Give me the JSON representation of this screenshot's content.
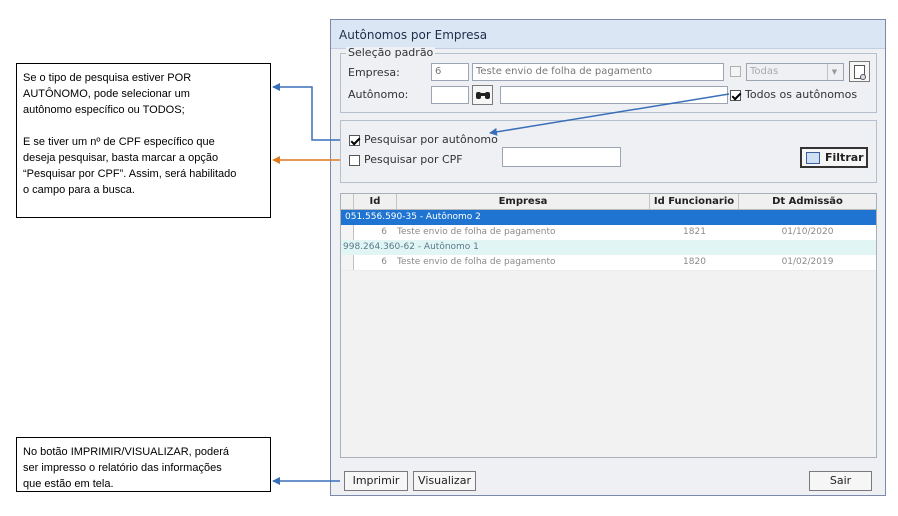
{
  "notes": {
    "note1": [
      "Se o tipo de pesquisa estiver POR",
      "AUTÔNOMO, pode selecionar um",
      "autônomo específico ou TODOS;",
      "",
      "E se tiver um nº de CPF específico que",
      "deseja pesquisar, basta marcar a opção",
      "“Pesquisar por CPF”. Assim, será habilitado",
      "o campo para a busca."
    ],
    "note2": [
      "No botão IMPRIMIR/VISUALIZAR, poderá",
      "ser impresso o relatório das informações",
      "que estão em tela."
    ]
  },
  "window": {
    "title": "Autônomos por Empresa"
  },
  "selecao": {
    "legend": "Seleção padrão",
    "empresa_label": "Empresa:",
    "empresa_code": "6",
    "empresa_name": "Teste envio de folha de pagamento",
    "todas_value": "Todas",
    "autonomo_label": "Autônomo:",
    "autonomo_code": "",
    "autonomo_name": "",
    "todos_label": "Todos os autônomos",
    "todos_checked": true
  },
  "pesquisa": {
    "por_autonomo_label": "Pesquisar por autônomo",
    "por_autonomo_checked": true,
    "por_cpf_label": "Pesquisar por CPF",
    "por_cpf_checked": false,
    "cpf_value": "",
    "filtrar_label": "Filtrar"
  },
  "grid": {
    "columns": [
      "Id",
      "Empresa",
      "Id Funcionario",
      "Dt Admissão"
    ],
    "groups": [
      {
        "header": "051.556.590-35 - Autônomo 2",
        "selected": true,
        "rows": [
          {
            "id": "6",
            "empresa": "Teste envio de folha de pagamento",
            "id_funcionario": "1821",
            "dt_admissao": "01/10/2020"
          }
        ]
      },
      {
        "header": "998.264.360-62 - Autônomo 1",
        "selected": false,
        "rows": [
          {
            "id": "6",
            "empresa": "Teste envio de folha de pagamento",
            "id_funcionario": "1820",
            "dt_admissao": "01/02/2019"
          }
        ]
      }
    ]
  },
  "footer": {
    "imprimir": "Imprimir",
    "visualizar": "Visualizar",
    "sair": "Sair"
  },
  "colors": {
    "selected_row": "#1e74d0",
    "arrow_blue": "#3a6fb8",
    "arrow_orange": "#e07a20"
  },
  "icons": [
    "binoculars-icon",
    "print-preview-icon",
    "filter-icon"
  ]
}
